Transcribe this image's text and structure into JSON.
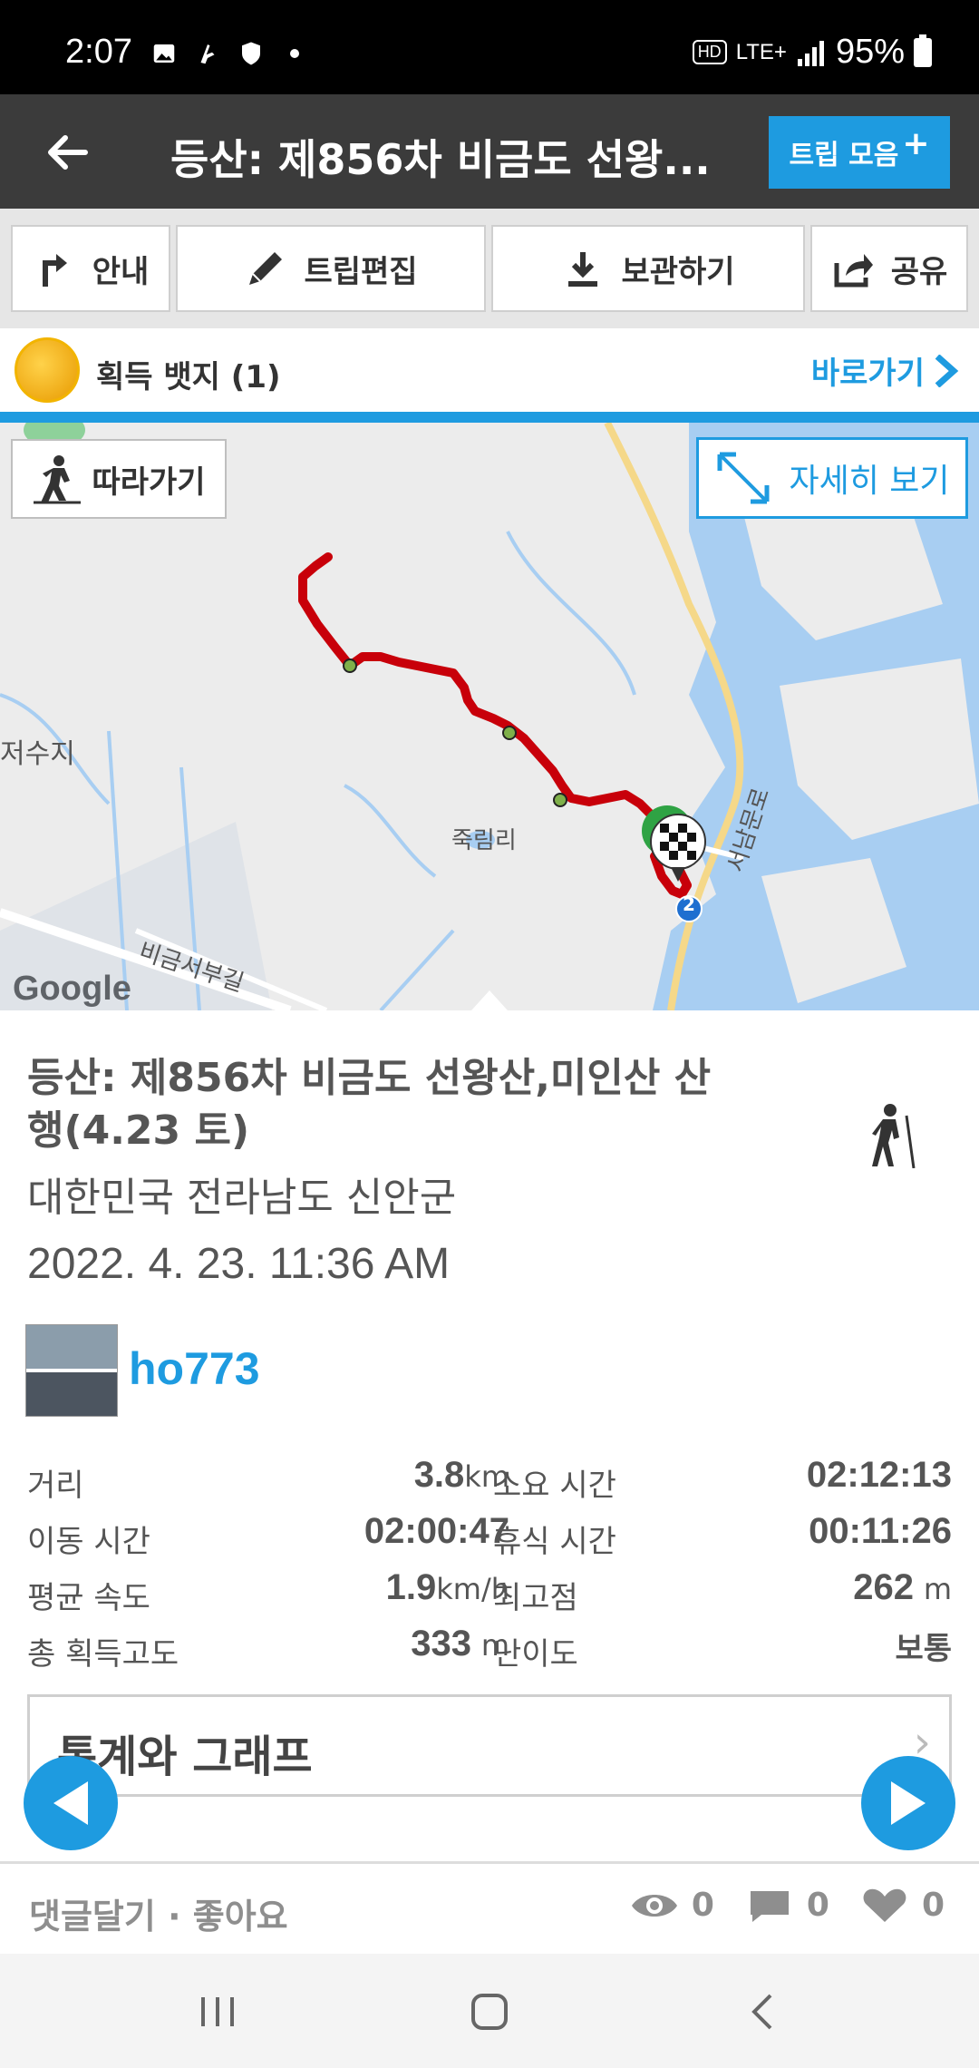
{
  "status_bar": {
    "time": "2:07",
    "network": "LTE+",
    "hd": "HD",
    "battery": "95%"
  },
  "header": {
    "title": "등산: 제856차 비금도 선왕...",
    "trip_collection_label": "트립 모음",
    "trip_collection_plus": "+"
  },
  "toolbar": {
    "guide_label": "안내",
    "edit_label": "트립편집",
    "save_label": "보관하기",
    "share_label": "공유"
  },
  "badge": {
    "label": "획득 뱃지 (1)",
    "goto_label": "바로가기"
  },
  "map": {
    "follow_label": "따라가기",
    "detail_label": "자세히 보기",
    "labels": {
      "reservoir": "저수지",
      "village": "죽림리",
      "road1": "비금서부길",
      "road2": "서남문로",
      "route_number": "2"
    },
    "attribution": "Google",
    "route_color": "#c8000a"
  },
  "trip": {
    "title": "등산: 제856차 비금도 선왕산,미인산 산행(4.23  토)",
    "location": "대한민국 전라남도 신안군",
    "datetime": "2022. 4. 23. 11:36 AM",
    "username": "ho773",
    "activity_icon": "hiker-icon"
  },
  "stats": {
    "distance_label": "거리",
    "distance_value": "3.8",
    "distance_unit": "km",
    "duration_label": "소요 시간",
    "duration_value": "02:12:13",
    "moving_label": "이동 시간",
    "moving_value": "02:00:47",
    "rest_label": "휴식 시간",
    "rest_value": "00:11:26",
    "avg_speed_label": "평균 속도",
    "avg_speed_value": "1.9",
    "avg_speed_unit": "km/h",
    "max_alt_label": "최고점",
    "max_alt_value": "262",
    "max_alt_unit": "m",
    "gain_label": "총 획득고도",
    "gain_value": "333",
    "gain_unit": "m",
    "difficulty_label": "난이도",
    "difficulty_value": "보통"
  },
  "graph": {
    "label": "통계와 그래프"
  },
  "social": {
    "comment_like_label": "댓글달기 · 좋아요",
    "views": "0",
    "comments": "0",
    "likes": "0"
  },
  "colors": {
    "accent": "#1e9be0",
    "header_bg": "#3b3b3b",
    "route": "#c8000a"
  }
}
